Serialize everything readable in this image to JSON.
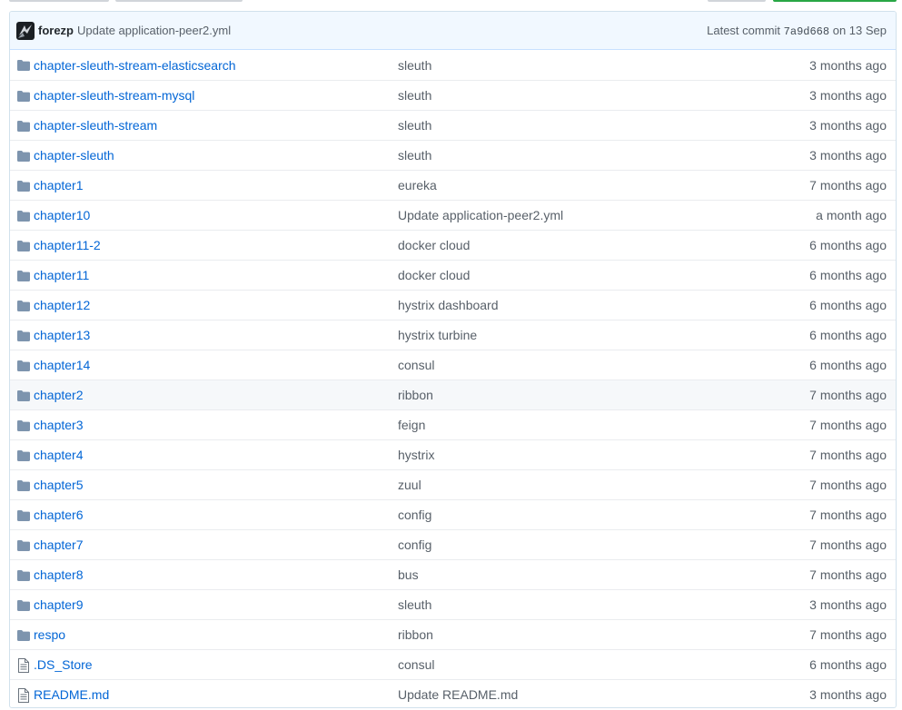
{
  "commit": {
    "author": "forezp",
    "message": "Update application-peer2.yml",
    "latest_label": "Latest commit",
    "sha": "7a9d668",
    "date": "on 13 Sep"
  },
  "icons": {
    "directory": "file-directory-icon",
    "file": "file-icon",
    "avatar": "avatar"
  },
  "colors": {
    "link": "#0366d6",
    "icon": "#7d94ae",
    "header_bg": "#f1f8ff",
    "hover_bg": "#f6f8fa"
  },
  "files": [
    {
      "type": "dir",
      "name": "chapter-sleuth-stream-elasticsearch",
      "message": "sleuth",
      "age": "3 months ago"
    },
    {
      "type": "dir",
      "name": "chapter-sleuth-stream-mysql",
      "message": "sleuth",
      "age": "3 months ago"
    },
    {
      "type": "dir",
      "name": "chapter-sleuth-stream",
      "message": "sleuth",
      "age": "3 months ago"
    },
    {
      "type": "dir",
      "name": "chapter-sleuth",
      "message": "sleuth",
      "age": "3 months ago"
    },
    {
      "type": "dir",
      "name": "chapter1",
      "message": "eureka",
      "age": "7 months ago"
    },
    {
      "type": "dir",
      "name": "chapter10",
      "message": "Update application-peer2.yml",
      "age": "a month ago"
    },
    {
      "type": "dir",
      "name": "chapter11-2",
      "message": "docker cloud",
      "age": "6 months ago"
    },
    {
      "type": "dir",
      "name": "chapter11",
      "message": "docker cloud",
      "age": "6 months ago"
    },
    {
      "type": "dir",
      "name": "chapter12",
      "message": "hystrix dashboard",
      "age": "6 months ago"
    },
    {
      "type": "dir",
      "name": "chapter13",
      "message": "hystrix turbine",
      "age": "6 months ago"
    },
    {
      "type": "dir",
      "name": "chapter14",
      "message": "consul",
      "age": "6 months ago"
    },
    {
      "type": "dir",
      "name": "chapter2",
      "message": "ribbon",
      "age": "7 months ago",
      "hover": true
    },
    {
      "type": "dir",
      "name": "chapter3",
      "message": "feign",
      "age": "7 months ago"
    },
    {
      "type": "dir",
      "name": "chapter4",
      "message": "hystrix",
      "age": "7 months ago"
    },
    {
      "type": "dir",
      "name": "chapter5",
      "message": "zuul",
      "age": "7 months ago"
    },
    {
      "type": "dir",
      "name": "chapter6",
      "message": "config",
      "age": "7 months ago"
    },
    {
      "type": "dir",
      "name": "chapter7",
      "message": "config",
      "age": "7 months ago"
    },
    {
      "type": "dir",
      "name": "chapter8",
      "message": "bus",
      "age": "7 months ago"
    },
    {
      "type": "dir",
      "name": "chapter9",
      "message": "sleuth",
      "age": "3 months ago"
    },
    {
      "type": "dir",
      "name": "respo",
      "message": "ribbon",
      "age": "7 months ago"
    },
    {
      "type": "file",
      "name": ".DS_Store",
      "message": "consul",
      "age": "6 months ago"
    },
    {
      "type": "file",
      "name": "README.md",
      "message": "Update README.md",
      "age": "3 months ago"
    }
  ]
}
